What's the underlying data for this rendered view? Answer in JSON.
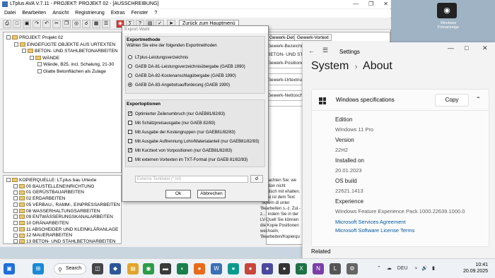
{
  "app": {
    "title": "LTplus AVA V.7.11 - PROJEKT: PROJEKT 02 - [AUSSCHREIBUNG]",
    "menu": [
      "Datei",
      "Bearbeiten",
      "Ansicht",
      "Registrierung",
      "Extras",
      "Fenster",
      "?"
    ],
    "toolbar_back": "Zurück zum Hauptmenü"
  },
  "tree_top": [
    {
      "label": "PROJEKT: Projekt 02",
      "level": 0,
      "type": "folder"
    },
    {
      "label": "EINGEFÜGTE OBJEKTE AUS URTEXTEN",
      "level": 1,
      "type": "folder"
    },
    {
      "label": "BETON- UND STAHLBETONARBEITEN",
      "level": 2,
      "type": "folder"
    },
    {
      "label": "WÄNDE",
      "level": 3,
      "type": "folder"
    },
    {
      "label": "Wände, B25, incl. Schalung, 21-30",
      "level": 4,
      "type": "item"
    },
    {
      "label": "Glatte Betonflächen als Zulage",
      "level": 4,
      "type": "item"
    }
  ],
  "tree_bottom": [
    {
      "label": "KOPIERQUELLE: LT.plus bau Urtexte",
      "level": 0
    },
    {
      "label": "00 BAUSTELLENEINRICHTUNG",
      "level": 1
    },
    {
      "label": "01 GERÜSTBAUARBEITEN",
      "level": 1
    },
    {
      "label": "02 ERDARBEITEN",
      "level": 1
    },
    {
      "label": "05 VERBAU-, RAMM-, EINPRESSARBEITEN",
      "level": 1
    },
    {
      "label": "08 WASSERHALTUNGSARBEITEN",
      "level": 1
    },
    {
      "label": "09 ENTWÄSSERUNGSKANALARBEITEN",
      "level": 1
    },
    {
      "label": "10 DRÄNARBEITEN",
      "level": 1
    },
    {
      "label": "11 ABSCHEIDER UND KLEINKLÄRANLAGE",
      "level": 1
    },
    {
      "label": "12 MAUERARBEITEN",
      "level": 1
    },
    {
      "label": "13 BETON- UND STAHLBETONARBEITEN",
      "level": 1
    }
  ],
  "right_panel": {
    "tabs": [
      "Gewerk-Details",
      "Gewerk-Vortext"
    ],
    "labels": [
      "Gewerk-Bezeichnung",
      "BETON- UND STAHL",
      "Gewerk-Positionen",
      "Gewerk-Urtextnum",
      "Gewerk-Nettosch"
    ],
    "bottom_text": "e beachten Sie: we Position nicht identisch mit ehalten. Diese ist dem Text \"Sofern di unter 'Bearbeiten s.-z. Zul.-z...' indem Sie in der LV-Quell Sie können die Kopie Positionen wechseln, 'Bearbeiten/Kopierqu"
  },
  "dialog": {
    "title": "Export-Wahl",
    "method_header": "Exportmethode",
    "method_sub": "Wählen Sie eine der folgenden Exportmethoden",
    "methods": [
      {
        "label": "LTplus-Leistungsverzeichnis",
        "selected": false
      },
      {
        "label": "GAEB DA-81-Leistungsverzeichnisübergabe (GAEB 1990)",
        "selected": false
      },
      {
        "label": "GAEB DA-82-Kostenanschlagübergabe (GAEB 1990)",
        "selected": false
      },
      {
        "label": "GAEB DA-83-Angebotsaufforderung (GAEB 1990)",
        "selected": true
      }
    ],
    "options_header": "Exportoptionen",
    "options": [
      {
        "label": "Optimierter Zeilenumbruch (nur GAEB81/82/83)",
        "checked": true
      },
      {
        "label": "Mit Schätzpreisausgabe (nur GAEB 82/83)",
        "checked": false
      },
      {
        "label": "Mit Ausgabe der Kostengruppen (nur GAEB81/82/83)",
        "checked": false
      },
      {
        "label": "Mit Ausgabe Auftrennung Lohn/Materialanteil (nur GAEB81/82/83)",
        "checked": false
      },
      {
        "label": "Mit Kurztext von Vorpositionen (nur GAEB81/82/83)",
        "checked": true
      },
      {
        "label": "Mit externen Vortexten im TXT-Format (nur GAEB 81/82/83)",
        "checked": false
      }
    ],
    "ext_file_placeholder": "Externe Textdatei (*.txt)",
    "ok": "Ok",
    "cancel": "Abbrechen"
  },
  "settings": {
    "app_title": "Settings",
    "crumb_parent": "System",
    "crumb_current": "About",
    "card_title": "Windows specifications",
    "copy_label": "Copy",
    "specs": [
      {
        "label": "Edition",
        "value": "Windows 11 Pro"
      },
      {
        "label": "Version",
        "value": "22H2"
      },
      {
        "label": "Installed on",
        "value": "20.01.2023"
      },
      {
        "label": "OS build",
        "value": "22621.1413"
      },
      {
        "label": "Experience",
        "value": "Windows Feature Experience Pack 1000.22639.1000.0"
      }
    ],
    "links": [
      "Microsoft Services Agreement",
      "Microsoft Software License Terms"
    ],
    "related": "Related"
  },
  "desktop": {
    "icon_label": "Windows Fotoanzeige"
  },
  "taskbar": {
    "search": "Search",
    "lang": "DEU",
    "time": "10:41",
    "date": "20.09.2025"
  },
  "colors": {
    "accent": "#0055a0",
    "folder": "#e9c77a"
  }
}
